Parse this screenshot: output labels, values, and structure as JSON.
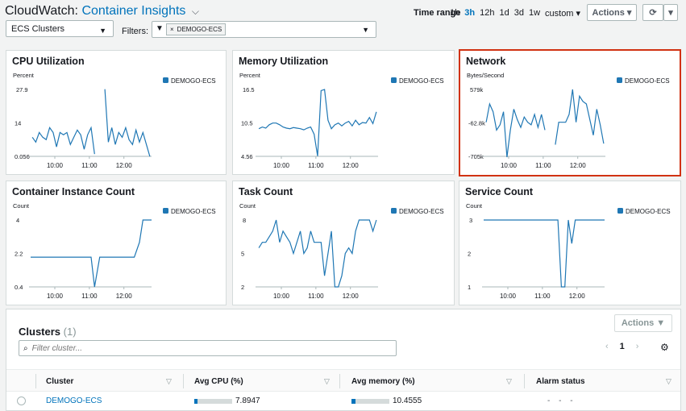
{
  "header": {
    "app": "CloudWatch:",
    "service": "Container Insights",
    "time_range_label": "Time range",
    "time_options": [
      "1h",
      "3h",
      "12h",
      "1d",
      "3d",
      "1w",
      "custom"
    ],
    "time_active": "3h",
    "actions_label": "Actions",
    "view_select": "ECS Clusters",
    "filters_label": "Filters:",
    "filter_token": "DEMOGO-ECS"
  },
  "colors": {
    "series": "#1f77b4",
    "link": "#0073bb",
    "highlight": "#d13212"
  },
  "panels": [
    {
      "title": "CPU Utilization",
      "unit": "Percent",
      "legend": "DEMOGO-ECS",
      "y_ticks": [
        "27.9",
        "14",
        "0.056"
      ],
      "x_ticks": [
        "10:00",
        "11:00",
        "12:00"
      ]
    },
    {
      "title": "Memory Utilization",
      "unit": "Percent",
      "legend": "DEMOGO-ECS",
      "y_ticks": [
        "16.5",
        "10.5",
        "4.56"
      ],
      "x_ticks": [
        "10:00",
        "11:00",
        "12:00"
      ]
    },
    {
      "title": "Network",
      "unit": "Bytes/Second",
      "legend": "DEMOGO-ECS",
      "y_ticks": [
        "579k",
        "-62.8k",
        "-705k"
      ],
      "x_ticks": [
        "10:00",
        "11:00",
        "12:00"
      ]
    },
    {
      "title": "Container Instance Count",
      "unit": "Count",
      "legend": "DEMOGO-ECS",
      "y_ticks": [
        "4",
        "2.2",
        "0.4"
      ],
      "x_ticks": [
        "10:00",
        "11:00",
        "12:00"
      ]
    },
    {
      "title": "Task Count",
      "unit": "Count",
      "legend": "DEMOGO-ECS",
      "y_ticks": [
        "8",
        "5",
        "2"
      ],
      "x_ticks": [
        "10:00",
        "11:00",
        "12:00"
      ]
    },
    {
      "title": "Service Count",
      "unit": "Count",
      "legend": "DEMOGO-ECS",
      "y_ticks": [
        "3",
        "2",
        "1"
      ],
      "x_ticks": [
        "10:00",
        "11:00",
        "12:00"
      ]
    }
  ],
  "chart_data": [
    {
      "type": "line",
      "title": "CPU Utilization",
      "ylabel": "Percent",
      "ylim": [
        0.056,
        27.9
      ],
      "x_ticks": [
        "10:00",
        "11:00",
        "12:00"
      ],
      "x_range": [
        9.3,
        12.8
      ],
      "series": [
        {
          "name": "DEMOGO-ECS",
          "x": [
            9.35,
            9.45,
            9.55,
            9.65,
            9.75,
            9.85,
            9.95,
            10.05,
            10.15,
            10.25,
            10.35,
            10.45,
            10.55,
            10.65,
            10.75,
            10.85,
            10.95,
            11.05,
            11.15
          ],
          "y": [
            8,
            6,
            10,
            8,
            7,
            12,
            10,
            4,
            10,
            9,
            10,
            5,
            8,
            11,
            9,
            3,
            9,
            12,
            1
          ]
        },
        {
          "name": "DEMOGO-ECS",
          "x": [
            11.45,
            11.55,
            11.65,
            11.75,
            11.85,
            11.95,
            12.05,
            12.15,
            12.25,
            12.35,
            12.45,
            12.55,
            12.65,
            12.75
          ],
          "y": [
            28,
            6,
            12,
            5,
            10,
            8,
            12,
            7,
            5,
            11,
            6,
            10,
            5,
            0
          ]
        }
      ]
    },
    {
      "type": "line",
      "title": "Memory Utilization",
      "ylabel": "Percent",
      "ylim": [
        4.56,
        16.5
      ],
      "x_ticks": [
        "10:00",
        "11:00",
        "12:00"
      ],
      "x_range": [
        9.3,
        12.8
      ],
      "series": [
        {
          "name": "DEMOGO-ECS",
          "x": [
            9.35,
            9.45,
            9.55,
            9.65,
            9.75,
            9.85,
            9.95,
            10.05,
            10.15,
            10.25,
            10.35,
            10.45,
            10.55,
            10.65,
            10.75,
            10.85,
            10.95,
            11.05,
            11.15,
            11.25,
            11.35,
            11.45,
            11.55,
            11.65,
            11.75,
            11.85,
            11.95,
            12.05,
            12.15,
            12.25,
            12.35,
            12.45,
            12.55,
            12.65,
            12.75
          ],
          "y": [
            9.5,
            9.8,
            9.6,
            10.2,
            10.5,
            10.5,
            10.2,
            9.8,
            9.6,
            9.5,
            9.7,
            9.6,
            9.5,
            9.3,
            9.6,
            9.8,
            8.5,
            4.6,
            16.3,
            16.5,
            11,
            9.5,
            10.2,
            10.5,
            10,
            10.5,
            10.8,
            10,
            11,
            10.2,
            10.6,
            10.5,
            11.5,
            10.4,
            12.5
          ]
        }
      ]
    },
    {
      "type": "line",
      "title": "Network",
      "ylabel": "Bytes/Second",
      "ylim": [
        -705000,
        579000
      ],
      "x_ticks": [
        "10:00",
        "11:00",
        "12:00"
      ],
      "x_range": [
        9.3,
        12.8
      ],
      "series": [
        {
          "name": "DEMOGO-ECS",
          "x": [
            9.35,
            9.45,
            9.55,
            9.65,
            9.75,
            9.85,
            9.95,
            10.05,
            10.15,
            10.25,
            10.35,
            10.45,
            10.55,
            10.65,
            10.75,
            10.85,
            10.95,
            11.05
          ],
          "y": [
            -50000,
            300000,
            150000,
            -200000,
            -100000,
            150000,
            -720000,
            -200000,
            200000,
            0,
            -150000,
            50000,
            -50000,
            -100000,
            100000,
            -150000,
            100000,
            -200000
          ]
        },
        {
          "name": "DEMOGO-ECS",
          "x": [
            11.35,
            11.45,
            11.55,
            11.65,
            11.75,
            11.85,
            11.95,
            12.05,
            12.15,
            12.25,
            12.35,
            12.45,
            12.55,
            12.65,
            12.75
          ],
          "y": [
            -480000,
            -50000,
            -50000,
            -50000,
            100000,
            580000,
            -50000,
            450000,
            350000,
            300000,
            0,
            -300000,
            200000,
            -100000,
            -460000
          ]
        }
      ]
    },
    {
      "type": "line",
      "title": "Container Instance Count",
      "ylabel": "Count",
      "ylim": [
        0.4,
        4
      ],
      "x_ticks": [
        "10:00",
        "11:00",
        "12:00"
      ],
      "x_range": [
        9.3,
        12.8
      ],
      "series": [
        {
          "name": "DEMOGO-ECS",
          "x": [
            9.3,
            9.8,
            10.3,
            10.85,
            11.05,
            11.15,
            11.3,
            11.5,
            12.0,
            12.3,
            12.45,
            12.55,
            12.8
          ],
          "y": [
            2.0,
            2.0,
            2.0,
            2.0,
            2.0,
            0.4,
            2.0,
            2.0,
            2.0,
            2.0,
            2.8,
            4.0,
            4.0
          ]
        }
      ]
    },
    {
      "type": "line",
      "title": "Task Count",
      "ylabel": "Count",
      "ylim": [
        2,
        8
      ],
      "x_ticks": [
        "10:00",
        "11:00",
        "12:00"
      ],
      "x_range": [
        9.3,
        12.8
      ],
      "series": [
        {
          "name": "DEMOGO-ECS",
          "x": [
            9.35,
            9.45,
            9.55,
            9.65,
            9.75,
            9.85,
            9.95,
            10.05,
            10.15,
            10.25,
            10.35,
            10.45,
            10.55,
            10.65,
            10.75,
            10.85,
            10.95,
            11.05,
            11.15,
            11.25,
            11.35,
            11.45,
            11.55,
            11.65,
            11.75,
            11.85,
            11.95,
            12.05,
            12.15,
            12.25,
            12.35,
            12.45,
            12.55,
            12.65,
            12.75
          ],
          "y": [
            5.5,
            6,
            6,
            6.5,
            7,
            8,
            6,
            7,
            6.5,
            6,
            5,
            6,
            7,
            5,
            5.5,
            7,
            6,
            6,
            6,
            3,
            5,
            7,
            2,
            2,
            3,
            5,
            5.5,
            5,
            7,
            8,
            8,
            8,
            8,
            7,
            8
          ]
        }
      ]
    },
    {
      "type": "line",
      "title": "Service Count",
      "ylabel": "Count",
      "ylim": [
        1,
        3
      ],
      "x_ticks": [
        "10:00",
        "11:00",
        "12:00"
      ],
      "x_range": [
        9.3,
        12.8
      ],
      "series": [
        {
          "name": "DEMOGO-ECS",
          "x": [
            9.3,
            9.8,
            10.3,
            10.8,
            11.3,
            11.45,
            11.55,
            11.65,
            11.75,
            11.85,
            11.95,
            12.05,
            12.3,
            12.55,
            12.8
          ],
          "y": [
            3,
            3,
            3,
            3,
            3,
            3,
            1,
            1,
            3,
            2.3,
            3,
            3,
            3,
            3,
            3
          ]
        }
      ]
    }
  ],
  "clusters": {
    "title": "Clusters",
    "count": "(1)",
    "actions_label": "Actions",
    "search_placeholder": "Filter cluster...",
    "page": "1",
    "columns": [
      "Cluster",
      "Avg CPU (%)",
      "Avg memory (%)",
      "Alarm status"
    ],
    "rows": [
      {
        "cluster": "DEMOGO-ECS",
        "cpu": "7.8947",
        "cpu_fraction": 0.079,
        "memory": "10.4555",
        "memory_fraction": 0.105,
        "alarm": "- - -"
      }
    ]
  }
}
